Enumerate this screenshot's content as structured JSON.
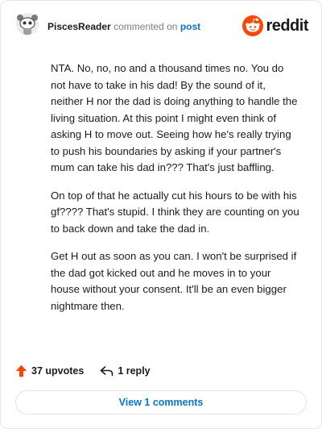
{
  "comment": {
    "author": "PiscesReader",
    "action_text": "commented on",
    "post_link": "post",
    "paragraphs": [
      "NTA. No, no, no and a thousand times no. You do not have to take in his dad! By the sound of it, neither H nor the dad is doing anything to handle the living situation. At this point I might even think of asking H to move out. Seeing how he's really trying to push his boundaries by asking if your partner's mum can take his dad in??? That's just baffling.",
      "On top of that he actually cut his hours to be with his gf???? That's stupid. I think they are counting on you to back down and take the dad in.",
      "Get H out as soon as you can. I won't be surprised if the dad got kicked out and he moves in to your house without your consent. It'll be an even bigger nightmare then."
    ]
  },
  "brand": {
    "wordmark": "reddit",
    "color": "#ff4500"
  },
  "actions": {
    "upvotes": "37 upvotes",
    "replies": "1 reply",
    "upvote_color": "#ff4500"
  },
  "view_button": {
    "label": "View 1 comments"
  },
  "icons": {
    "avatar": "snoo-avatar-icon",
    "logo": "reddit-logo-icon",
    "upvote": "upvote-arrow-icon",
    "reply": "reply-arrow-icon"
  }
}
